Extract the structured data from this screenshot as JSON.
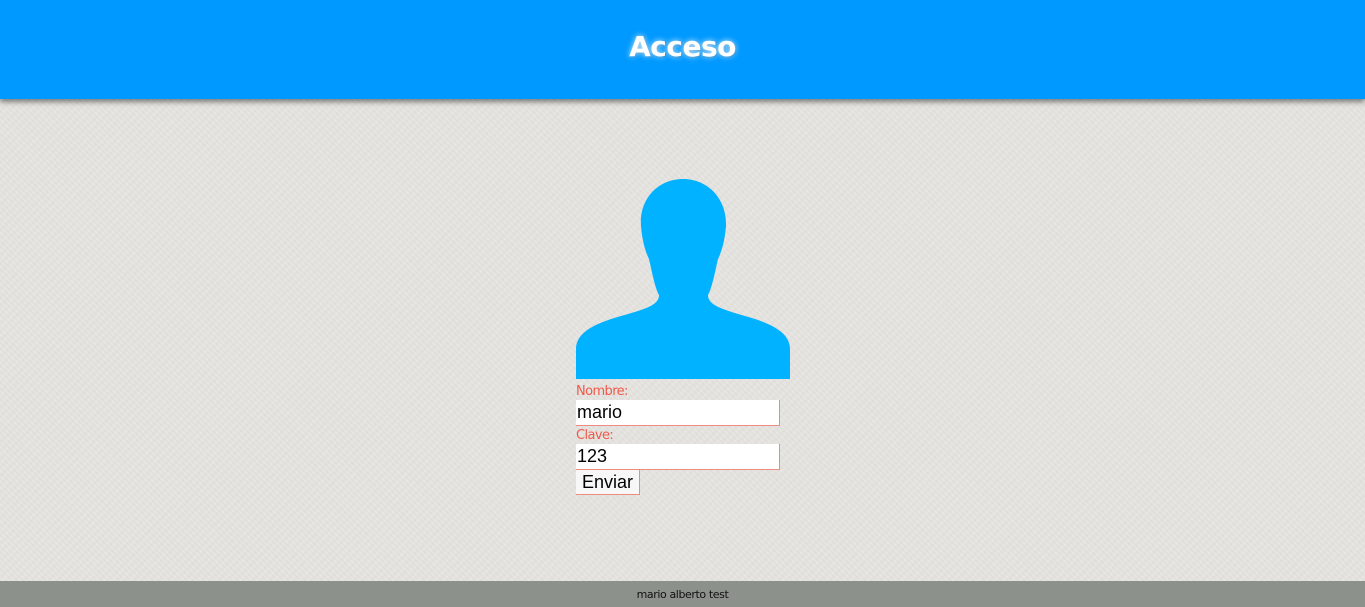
{
  "header": {
    "title": "Acceso"
  },
  "avatar": {
    "icon": "user-silhouette-icon",
    "color": "#00b2ff"
  },
  "login_form": {
    "name_label": "Nombre:",
    "name_value": "mario",
    "password_label": "Clave:",
    "password_value": "123",
    "submit_label": "Enviar"
  },
  "footer": {
    "text": "mario alberto test"
  },
  "colors": {
    "header_bg": "#0099ff",
    "label": "#f05a4a",
    "footer_bg": "#8d918b",
    "page_bg": "#e6e4e0"
  }
}
